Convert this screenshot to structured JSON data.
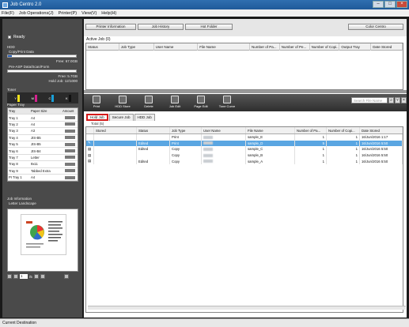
{
  "window": {
    "title": "Job Centro 2.0"
  },
  "menu": [
    "File(F)",
    "Job Operations(J)",
    "Printer(P)",
    "View(V)",
    "Help(H)"
  ],
  "left": {
    "status": "Ready",
    "hdd_label": "HDD",
    "copy_label": "Copy/Print Data",
    "copy_fill": 0.06,
    "copy_free": "Free: 67.0GB",
    "scan_label": "Pre-ASP Data/Scan/Form",
    "scan_free": "Free: 5.7GB",
    "hold_jobs": "Hold Job: 12/1000",
    "toner_label": "Toner",
    "toner": [
      {
        "name": "Y",
        "color": "#f2e21a"
      },
      {
        "name": "M",
        "color": "#d3218e"
      },
      {
        "name": "C",
        "color": "#1aa0d8"
      },
      {
        "name": "K",
        "color": "#111111"
      }
    ],
    "paper_tray_label": "Paper Tray",
    "tray_headers": [
      "Tray",
      "Paper Size",
      "Amount"
    ],
    "trays": [
      {
        "tray": "Tray 1",
        "size": "A4"
      },
      {
        "tray": "Tray 2",
        "size": "A4"
      },
      {
        "tray": "Tray 3",
        "size": "A3"
      },
      {
        "tray": "Tray 4",
        "size": "JIS-B5"
      },
      {
        "tray": "Tray 5",
        "size": "JIS-B5"
      },
      {
        "tray": "Tray 6",
        "size": "JIS-B4"
      },
      {
        "tray": "Tray 7",
        "size": "Letter"
      },
      {
        "tray": "Tray 8",
        "size": "9x11"
      },
      {
        "tray": "Tray 9",
        "size": "Tabbed Extra"
      },
      {
        "tray": "PI Tray 1",
        "size": "A4"
      }
    ],
    "job_info_label": "Job Information",
    "job_info_value": "Letter Landscape",
    "pager": {
      "page": "1",
      "total": "/5"
    }
  },
  "top_buttons": [
    "Printer Information",
    "Job History",
    "Hot Folder",
    "Color Centro"
  ],
  "active_job": {
    "label": "Active Job (0)",
    "headers": [
      "Status",
      "Job Type",
      "User Name",
      "File Name",
      "Number of Pa...",
      "Number of Pe...",
      "Number of Copi...",
      "Output Tray",
      "Date Stored"
    ]
  },
  "toolbar": {
    "tools": [
      "Print",
      "HDD Store",
      "Delete",
      "Job Edit",
      "Page Edit",
      "Tone Curve"
    ],
    "search_placeholder": "Search File Name"
  },
  "tabs": [
    "Hold Job",
    "Secure Job",
    "HDD Job"
  ],
  "hold_count": "Total (5)",
  "job_table": {
    "headers": [
      "Stored",
      "Status",
      "Job Type",
      "User Name",
      "File Name",
      "Number of Pa...",
      "Number of Copi...",
      "Date Stored"
    ],
    "rows": [
      {
        "status": "",
        "type": "Print",
        "file": "sample_E",
        "pages": "1",
        "copies": "1",
        "date": "16/Jun/2016 1:17"
      },
      {
        "status": "Edited",
        "type": "Print",
        "file": "sample_D",
        "pages": "5",
        "copies": "1",
        "date": "16/Jun/2016 5:50"
      },
      {
        "status": "Edited",
        "type": "Copy",
        "file": "sample_C",
        "pages": "1",
        "copies": "1",
        "date": "16/Jun/2016 5:50"
      },
      {
        "status": "",
        "type": "Copy",
        "file": "sample_B",
        "pages": "1",
        "copies": "1",
        "date": "16/Jun/2016 5:50"
      },
      {
        "status": "Edited",
        "type": "Copy",
        "file": "sample_A",
        "pages": "1",
        "copies": "1",
        "date": "16/Jun/2016 5:50"
      }
    ]
  },
  "statusbar": "Current Destination"
}
